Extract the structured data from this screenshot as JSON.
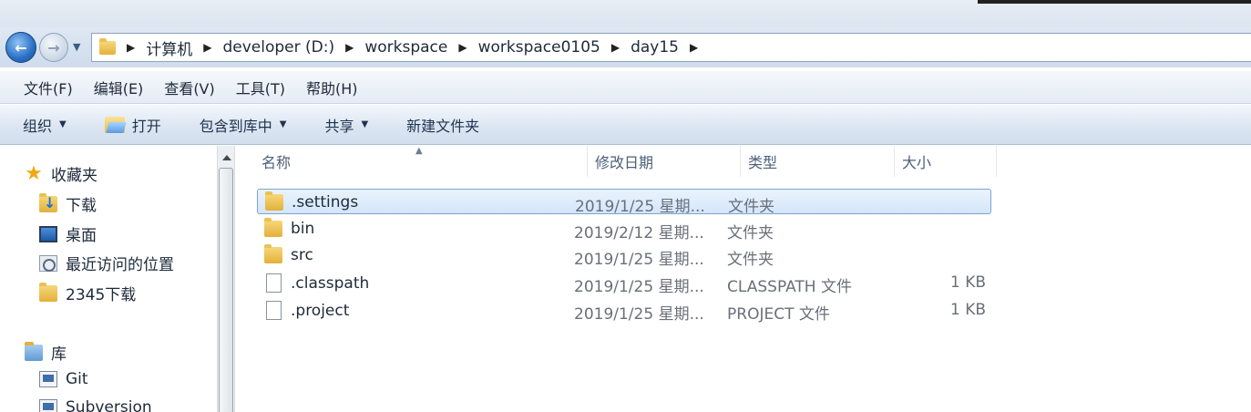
{
  "address_bar": {
    "breadcrumbs": [
      "计算机",
      "developer (D:)",
      "workspace",
      "workspace0105",
      "day15"
    ]
  },
  "menu": {
    "items": [
      "文件(F)",
      "编辑(E)",
      "查看(V)",
      "工具(T)",
      "帮助(H)"
    ]
  },
  "command_bar": {
    "organize": "组织",
    "open": "打开",
    "include_in_library": "包含到库中",
    "share": "共享",
    "new_folder": "新建文件夹"
  },
  "nav_pane": {
    "favorites_label": "收藏夹",
    "favorites": [
      "下载",
      "桌面",
      "最近访问的位置",
      "2345下载"
    ],
    "libraries_label": "库",
    "libraries": [
      "Git",
      "Subversion"
    ]
  },
  "columns": {
    "name": "名称",
    "modified": "修改日期",
    "type": "类型",
    "size": "大小"
  },
  "files": [
    {
      "name": ".settings",
      "modified": "2019/1/25 星期...",
      "type": "文件夹",
      "size": "",
      "icon": "folder-icon",
      "selected": true
    },
    {
      "name": "bin",
      "modified": "2019/2/12 星期...",
      "type": "文件夹",
      "size": "",
      "icon": "folder-icon",
      "selected": false
    },
    {
      "name": "src",
      "modified": "2019/1/25 星期...",
      "type": "文件夹",
      "size": "",
      "icon": "folder-icon",
      "selected": false
    },
    {
      "name": ".classpath",
      "modified": "2019/1/25 星期...",
      "type": "CLASSPATH 文件",
      "size": "1 KB",
      "icon": "file-icon",
      "selected": false
    },
    {
      "name": ".project",
      "modified": "2019/1/25 星期...",
      "type": "PROJECT 文件",
      "size": "1 KB",
      "icon": "file-icon",
      "selected": false
    }
  ]
}
